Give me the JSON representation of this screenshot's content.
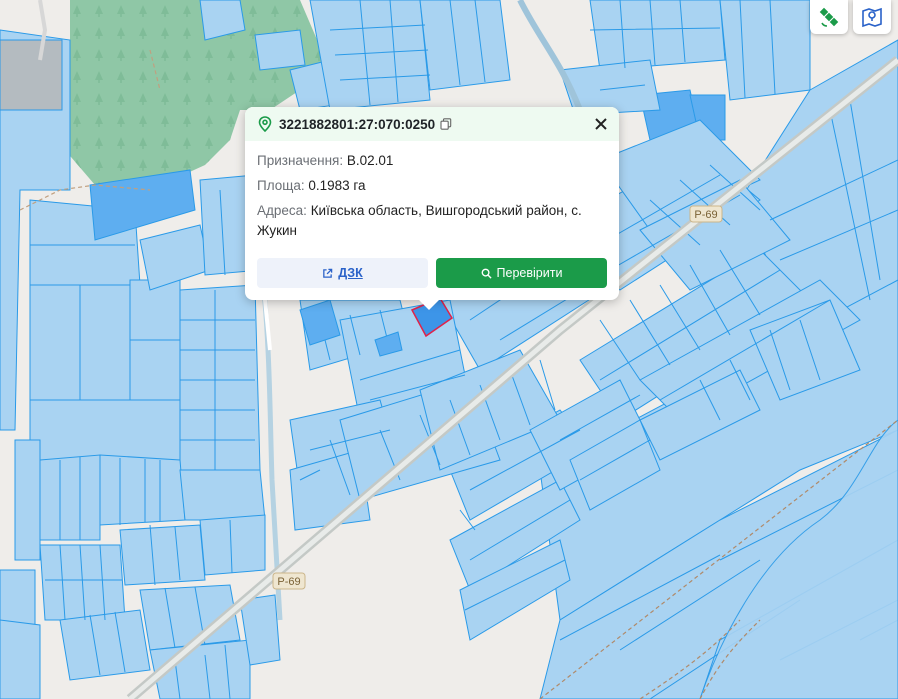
{
  "map": {
    "road_label": "Р-69",
    "colors": {
      "background": "#efedea",
      "parcel_fill": "#a9d3f2",
      "parcel_stroke": "#2a9ae8",
      "selected_fill": "#3d95e8",
      "selected_stroke": "#e0234a",
      "forest": "#8fc7a6",
      "road": "#c4c9c6"
    }
  },
  "controls": {
    "left_icon": "satellite-icon",
    "right_icon": "map-icon"
  },
  "popup": {
    "cadastral_number": "3221882801:27:070:0250",
    "purpose_label": "Призначення:",
    "purpose_value": "В.02.01",
    "area_label": "Площа:",
    "area_value": "0.1983 га",
    "address_label": "Адреса:",
    "address_value": "Київська область, Вишгородський район, с. Жукин",
    "dzk_button": "ДЗК",
    "check_button": "Перевірити",
    "accent_color": "#1b9b49"
  }
}
